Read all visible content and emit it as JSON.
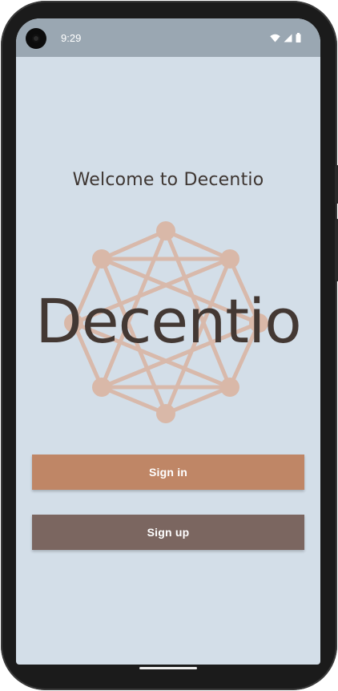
{
  "status_bar": {
    "time": "9:29",
    "icons": [
      "wifi-icon",
      "cellular-signal-icon",
      "battery-icon"
    ]
  },
  "welcome": {
    "title": "Welcome to Decentio"
  },
  "logo": {
    "wordmark": "Decentio",
    "network_color": "#d9b8a8",
    "text_color": "#433833"
  },
  "buttons": {
    "sign_in_label": "Sign in",
    "sign_up_label": "Sign up"
  },
  "colors": {
    "background": "#d3dee8",
    "status_bar": "#9aa7b2",
    "sign_in": "#bf8666",
    "sign_up": "#7b6660"
  }
}
